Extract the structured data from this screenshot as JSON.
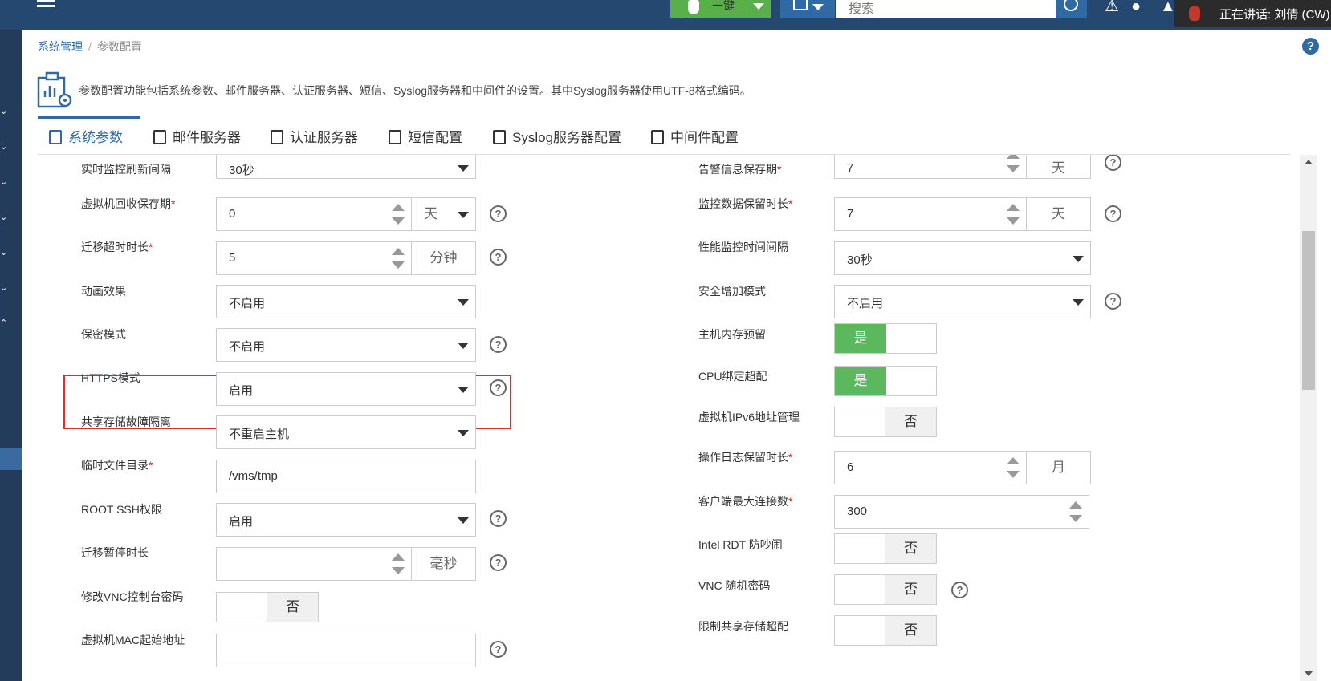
{
  "topbar": {
    "one_click_label": "一键",
    "search_placeholder": "搜索",
    "speaking_text": "正在讲话: 刘倩 (CW)"
  },
  "breadcrumb": {
    "parent": "系统管理",
    "separator": "/",
    "current": "参数配置"
  },
  "description": "参数配置功能包括系统参数、邮件服务器、认证服务器、短信、Syslog服务器和中间件的设置。其中Syslog服务器使用UTF-8格式编码。",
  "tabs": [
    {
      "label": "系统参数",
      "icon": "system-params-icon",
      "active": true
    },
    {
      "label": "邮件服务器",
      "icon": "mail-icon",
      "active": false
    },
    {
      "label": "认证服务器",
      "icon": "auth-icon",
      "active": false
    },
    {
      "label": "短信配置",
      "icon": "sms-icon",
      "active": false
    },
    {
      "label": "Syslog服务器配置",
      "icon": "syslog-icon",
      "active": false
    },
    {
      "label": "中间件配置",
      "icon": "middleware-icon",
      "active": false
    }
  ],
  "left_fields": [
    {
      "label": "实时监控刷新间隔",
      "required": false,
      "type": "select",
      "value": "30秒"
    },
    {
      "label": "虚拟机回收保存期",
      "required": true,
      "type": "spinner-select",
      "value": "0",
      "unit": "天",
      "help": true
    },
    {
      "label": "迁移超时时长",
      "required": true,
      "type": "spinner-unit",
      "value": "5",
      "unit": "分钟",
      "help": true
    },
    {
      "label": "动画效果",
      "required": false,
      "type": "select",
      "value": "不启用"
    },
    {
      "label": "保密模式",
      "required": false,
      "type": "select",
      "value": "不启用",
      "help": true
    },
    {
      "label": "HTTPS模式",
      "required": false,
      "type": "select",
      "value": "启用",
      "help": true
    },
    {
      "label": "共享存储故障隔离",
      "required": false,
      "type": "select",
      "value": "不重启主机"
    },
    {
      "label": "临时文件目录",
      "required": true,
      "type": "text",
      "value": "/vms/tmp"
    },
    {
      "label": "ROOT SSH权限",
      "required": false,
      "type": "select",
      "value": "启用",
      "help": true
    },
    {
      "label": "迁移暂停时长",
      "required": false,
      "type": "spinner-unit",
      "value": "",
      "unit": "毫秒",
      "help": true
    },
    {
      "label": "修改VNC控制台密码",
      "required": false,
      "type": "toggle",
      "value": "否"
    },
    {
      "label": "虚拟机MAC起始地址",
      "required": false,
      "type": "text",
      "value": "",
      "help": true
    }
  ],
  "right_fields": [
    {
      "label": "告警信息保存期",
      "required": true,
      "type": "spinner-unit",
      "value": "7",
      "unit": "天",
      "help": true
    },
    {
      "label": "监控数据保留时长",
      "required": true,
      "type": "spinner-unit",
      "value": "7",
      "unit": "天",
      "help": true
    },
    {
      "label": "性能监控时间间隔",
      "required": false,
      "type": "select",
      "value": "30秒"
    },
    {
      "label": "安全增加模式",
      "required": false,
      "type": "select",
      "value": "不启用",
      "help": true
    },
    {
      "label": "主机内存预留",
      "required": false,
      "type": "toggle",
      "value": "是"
    },
    {
      "label": "CPU绑定超配",
      "required": false,
      "type": "toggle",
      "value": "是"
    },
    {
      "label": "虚拟机IPv6地址管理",
      "required": false,
      "type": "toggle",
      "value": "否"
    },
    {
      "label": "操作日志保留时长",
      "required": true,
      "type": "spinner-unit",
      "value": "6",
      "unit": "月"
    },
    {
      "label": "客户端最大连接数",
      "required": true,
      "type": "spinner",
      "value": "300"
    },
    {
      "label": "Intel RDT 防吵闹",
      "required": false,
      "type": "toggle",
      "value": "否"
    },
    {
      "label": "VNC 随机密码",
      "required": false,
      "type": "toggle",
      "value": "否",
      "help": true
    },
    {
      "label": "限制共享存储超配",
      "required": false,
      "type": "toggle",
      "value": "否"
    }
  ],
  "required_mark": "*",
  "help_glyph": "?",
  "colors": {
    "topbar": "#24486f",
    "accent": "#2f6aa5",
    "toggle_on": "#5cb85c",
    "highlight_border": "#d9302c",
    "required": "#e02020"
  }
}
